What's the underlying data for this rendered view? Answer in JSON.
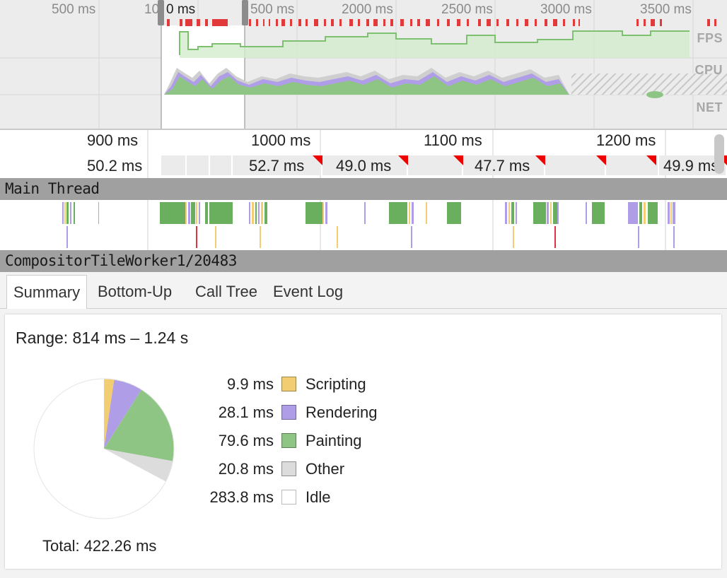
{
  "overview": {
    "ticks": [
      "500 ms",
      "10",
      "0 ms",
      "500 ms",
      "2000 ms",
      "2500 ms",
      "3000 ms",
      "3500 ms"
    ],
    "tracks": {
      "fps": "FPS",
      "cpu": "CPU",
      "net": "NET"
    }
  },
  "ruler": {
    "ticks": [
      "900 ms",
      "1000 ms",
      "1100 ms",
      "1200 ms"
    ],
    "frames": [
      "50.2 ms",
      "52.7 ms",
      "49.0 ms",
      "47.7 ms",
      "49.9 ms"
    ]
  },
  "threads": {
    "main": "Main Thread",
    "compositor": "CompositorTileWorker1/20483"
  },
  "tabs": [
    "Summary",
    "Bottom-Up",
    "Call Tree",
    "Event Log"
  ],
  "summary": {
    "range": "Range: 814 ms – 1.24 s",
    "total": "Total: 422.26 ms",
    "items": [
      {
        "value": "9.9 ms",
        "label": "Scripting",
        "color": "#f2cd71",
        "ms": 9.9
      },
      {
        "value": "28.1 ms",
        "label": "Rendering",
        "color": "#b09de8",
        "ms": 28.1
      },
      {
        "value": "79.6 ms",
        "label": "Painting",
        "color": "#8fc584",
        "ms": 79.6
      },
      {
        "value": "20.8 ms",
        "label": "Other",
        "color": "#dcdcdc",
        "ms": 20.8
      },
      {
        "value": "283.8 ms",
        "label": "Idle",
        "color": "#ffffff",
        "ms": 283.8
      }
    ]
  },
  "colors": {
    "scripting": "#f2cd71",
    "rendering": "#b09de8",
    "painting": "#8fc584",
    "painting_dark": "#6aaf5e",
    "frame_red": "#e23a3a"
  }
}
